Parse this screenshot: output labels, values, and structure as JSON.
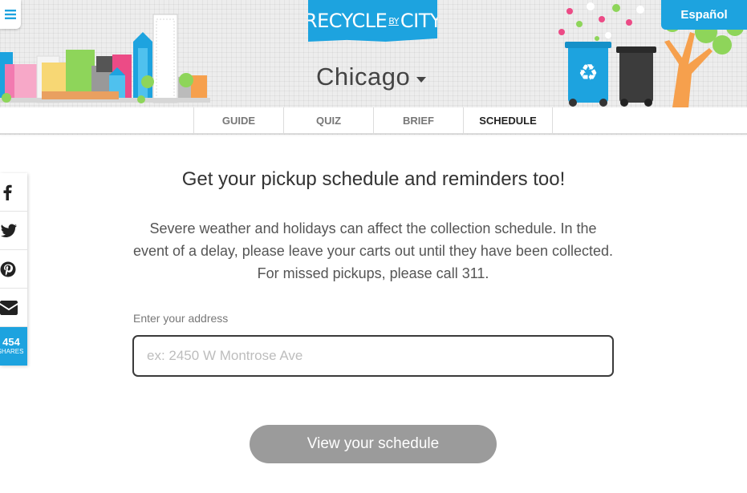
{
  "header": {
    "logo": {
      "left": "RECYCLE",
      "by": "BY",
      "right": "CITY"
    },
    "city": "Chicago",
    "language_button": "Español",
    "menu_icon": "hamburger-icon"
  },
  "nav": {
    "tabs": [
      {
        "label": "GUIDE",
        "active": false
      },
      {
        "label": "QUIZ",
        "active": false
      },
      {
        "label": "BRIEF",
        "active": false
      },
      {
        "label": "SCHEDULE",
        "active": true
      }
    ]
  },
  "share": {
    "icons": [
      "facebook-icon",
      "twitter-icon",
      "pinterest-icon",
      "email-icon"
    ],
    "count": "454",
    "count_label": "SHARES"
  },
  "main": {
    "headline": "Get your pickup schedule and reminders too!",
    "description": "Severe weather and holidays can affect the collection schedule. In the event of a delay, please leave your carts out until they have been collected. For missed pickups, please call 311.",
    "address_label": "Enter your address",
    "address_value": "",
    "address_placeholder": "ex: 2450 W Montrose Ave",
    "submit_label": "View your schedule"
  },
  "colors": {
    "brand_blue": "#1da3df",
    "button_disabled": "#9b9b9b",
    "header_bg": "#ededed"
  }
}
